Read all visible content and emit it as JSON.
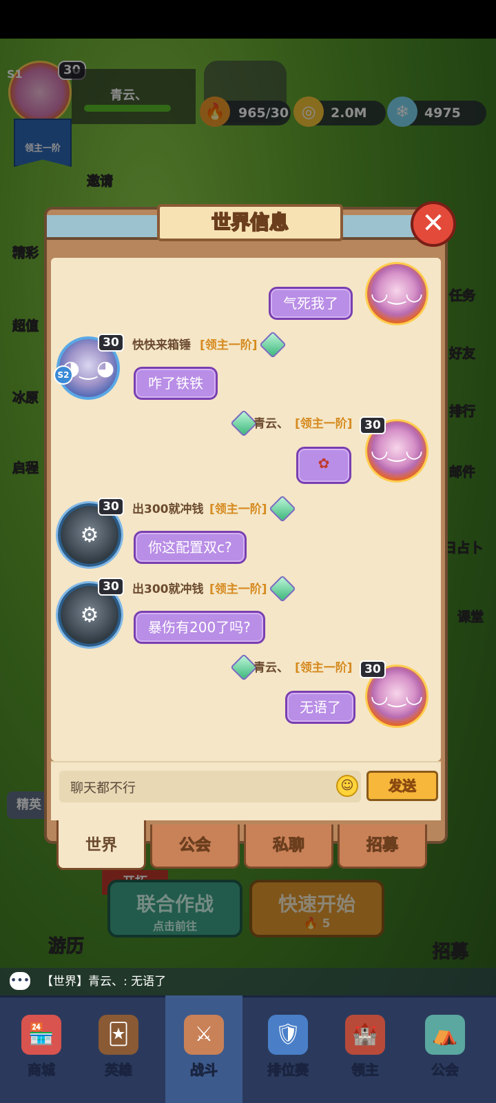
{
  "colors": {
    "panel": "#b7865c",
    "chat_bg": "#f4e6c7",
    "bubble": "#b98ee6",
    "rank": "#d68a1f"
  },
  "player": {
    "level": "30",
    "server": "S1",
    "name": "青云、",
    "rank_badge": "领主一阶"
  },
  "resources": {
    "stamina": "965/30",
    "gold": "2.0M",
    "gems": "4975"
  },
  "left_menu": [
    "邀请",
    "精彩",
    "超值",
    "冰原",
    "启程"
  ],
  "right_menu": [
    "任务",
    "好友",
    "排行",
    "邮件",
    "日占卜",
    "课堂"
  ],
  "dialog": {
    "title": "世界信息",
    "close_icon": "close-icon",
    "messages": [
      {
        "side": "right",
        "name": "",
        "rank": "",
        "text": "气死我了",
        "level": "",
        "avatar": "girl"
      },
      {
        "side": "left",
        "name": "快快来箱锤",
        "rank": "[领主一阶]",
        "text": "咋了铁铁",
        "level": "30",
        "avatar": "knight",
        "badge": "S2"
      },
      {
        "side": "right",
        "name": "青云、",
        "rank": "[领主一阶]",
        "text": "flower-sticker",
        "level": "30",
        "avatar": "girl"
      },
      {
        "side": "left",
        "name": "出300就冲钱",
        "rank": "[领主一阶]",
        "text": "你这配置双c?",
        "level": "30",
        "avatar": "monster"
      },
      {
        "side": "left",
        "name": "出300就冲钱",
        "rank": "[领主一阶]",
        "text": "暴伤有200了吗?",
        "level": "30",
        "avatar": "monster"
      },
      {
        "side": "right",
        "name": "青云、",
        "rank": "[领主一阶]",
        "text": "无语了",
        "level": "30",
        "avatar": "girl"
      }
    ],
    "input_value": "聊天都不行",
    "send_label": "发送",
    "tabs": [
      "世界",
      "公会",
      "私聊",
      "招募"
    ]
  },
  "hud": {
    "elite_label": "精英",
    "expand_label": "开拓",
    "coop_title": "联合作战",
    "coop_sub": "点击前往",
    "quick_title": "快速开始",
    "quick_cost": "5",
    "travel_label": "游历",
    "recruit_label": "招募",
    "ticker": "【世界】青云、: 无语了"
  },
  "nav": [
    "商城",
    "英雄",
    "战斗",
    "排位赛",
    "领主",
    "公会"
  ]
}
